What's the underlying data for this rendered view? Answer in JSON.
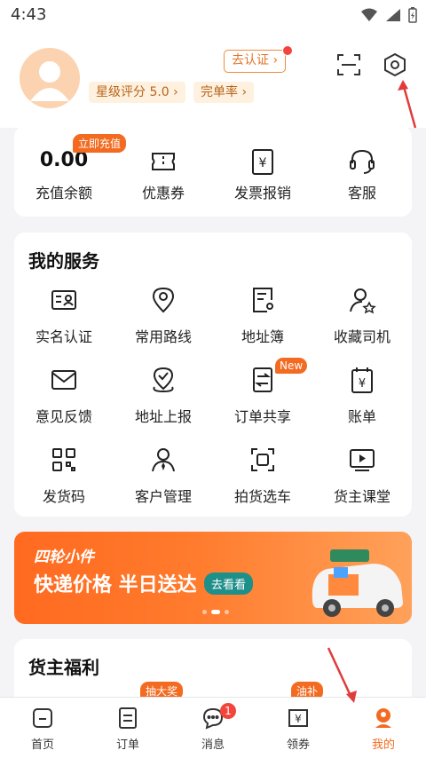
{
  "status_bar": {
    "time": "4:43"
  },
  "profile": {
    "rating_label": "星级评分 5.0",
    "completion_label": "完单率",
    "verify_label": "去认证"
  },
  "quick": {
    "balance_value": "0.00",
    "balance_label": "充值余额",
    "topup_tag": "立即充值",
    "coupon_label": "优惠券",
    "invoice_label": "发票报销",
    "service_label": "客服"
  },
  "services": {
    "title": "我的服务",
    "items": [
      {
        "label": "实名认证",
        "icon": "id-card-icon"
      },
      {
        "label": "常用路线",
        "icon": "location-pin-icon"
      },
      {
        "label": "地址簿",
        "icon": "address-book-icon"
      },
      {
        "label": "收藏司机",
        "icon": "favorite-driver-icon"
      },
      {
        "label": "意见反馈",
        "icon": "mail-icon"
      },
      {
        "label": "地址上报",
        "icon": "location-check-icon"
      },
      {
        "label": "订单共享",
        "icon": "order-share-icon"
      },
      {
        "label": "账单",
        "icon": "bill-icon"
      },
      {
        "label": "发货码",
        "icon": "qr-code-icon"
      },
      {
        "label": "客户管理",
        "icon": "customer-icon"
      },
      {
        "label": "拍货选车",
        "icon": "camera-scan-icon"
      },
      {
        "label": "货主课堂",
        "icon": "video-play-icon"
      }
    ],
    "new_tag": "New"
  },
  "banner": {
    "subtitle": "四轮小件",
    "title": "快递价格 半日送达",
    "button": "去看看"
  },
  "welfare": {
    "title": "货主福利",
    "tag1": "抽大奖",
    "tag2": "油补"
  },
  "tabbar": {
    "items": [
      {
        "label": "首页"
      },
      {
        "label": "订单"
      },
      {
        "label": "消息"
      },
      {
        "label": "领券"
      },
      {
        "label": "我的"
      }
    ],
    "message_badge": "1"
  },
  "colors": {
    "accent": "#f36b21",
    "arrow": "#e23b3b"
  }
}
